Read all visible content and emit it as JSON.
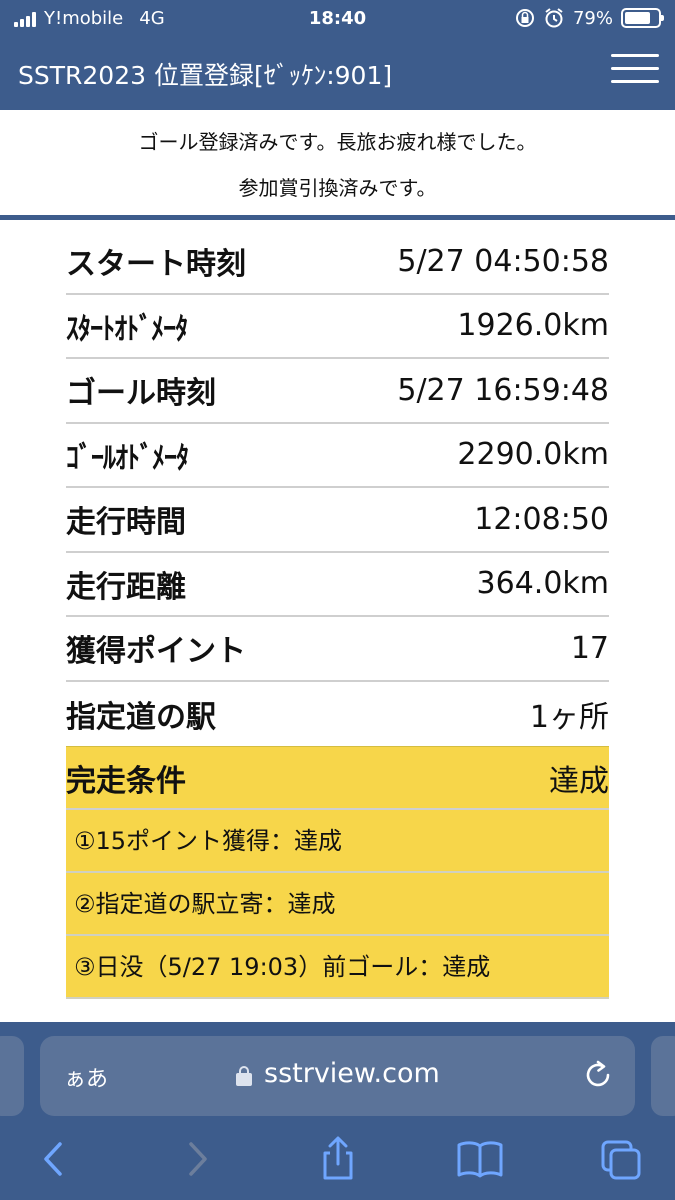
{
  "status_bar": {
    "carrier": "Y!mobile",
    "network": "4G",
    "time": "18:40",
    "battery": "79%"
  },
  "nav": {
    "title": "SSTR2023 位置登録[ｾﾞｯｹﾝ:901]"
  },
  "notice": {
    "line1": "ゴール登録済みです。長旅お疲れ様でした。",
    "line2": "参加賞引換済みです。"
  },
  "rows": [
    {
      "label": "スタート時刻",
      "value": "5/27 04:50:58"
    },
    {
      "label": "ｽﾀｰﾄｵﾄﾞﾒｰﾀ",
      "value": "1926.0km"
    },
    {
      "label": "ゴール時刻",
      "value": "5/27 16:59:48"
    },
    {
      "label": "ｺﾞｰﾙｵﾄﾞﾒｰﾀ",
      "value": "2290.0km"
    },
    {
      "label": "走行時間",
      "value": "12:08:50"
    },
    {
      "label": "走行距離",
      "value": "364.0km"
    },
    {
      "label": "獲得ポイント",
      "value": "17"
    },
    {
      "label": "指定道の駅",
      "value": "1ヶ所"
    }
  ],
  "completion": {
    "label": "完走条件",
    "value": "達成",
    "items": [
      "①15ポイント獲得：達成",
      "②指定道の駅立寄：達成",
      "③日没（5/27 19:03）前ゴール：達成"
    ]
  },
  "browser": {
    "aa": "ぁあ",
    "url": "sstrview.com"
  },
  "colors": {
    "header": "#3d5c8c",
    "highlight": "#f7d64a"
  },
  "icons": [
    "signal-icon",
    "lock-rotation-icon",
    "alarm-icon",
    "battery-icon",
    "menu-icon",
    "lock-icon",
    "reload-icon",
    "back-icon",
    "forward-icon",
    "share-icon",
    "bookmarks-icon",
    "tabs-icon"
  ]
}
